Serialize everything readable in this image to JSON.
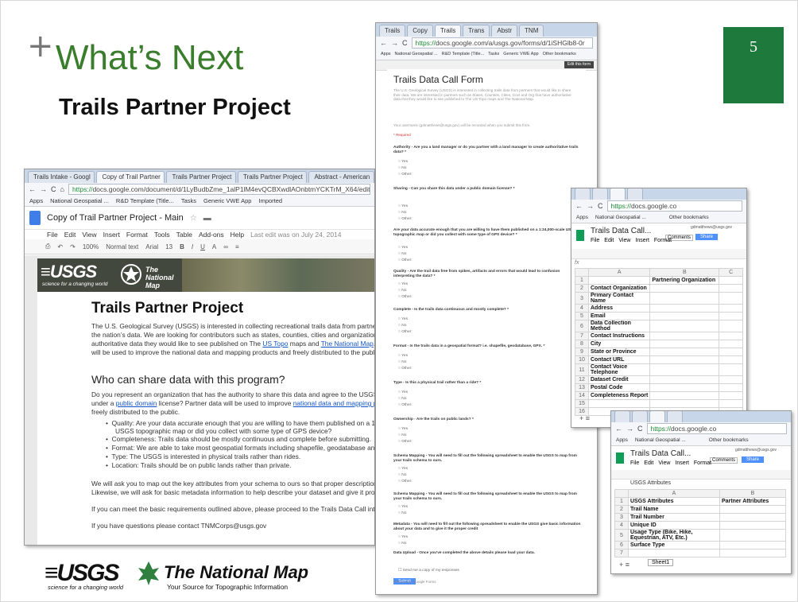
{
  "slide": {
    "plus": "+",
    "title": "What’s Next",
    "subtitle": "Trails Partner Project",
    "page_number": "5",
    "page_box_color": "#1e7a3c",
    "title_color": "#3a7d2c"
  },
  "docs_window": {
    "tabs": [
      "Trails Intake - Googl",
      "Copy of Trail Partner",
      "Trails Partner Project",
      "Trails Partner Project",
      "Abstract - American"
    ],
    "active_tab_index": 1,
    "url_scheme": "https://",
    "url_rest": "docs.google.com/document/d/1LyBudbZme_1alP1lM4evQCBXwdlAOnbtmYCKTrM_X64/edit",
    "bookmarks": [
      "Apps",
      "National Geospatial ...",
      "R&D Template (Title...",
      "Tasks",
      "Generic VWE App",
      "Imported"
    ],
    "doc_title": "Copy of Trail Partner Project - Main",
    "menu": [
      "File",
      "Edit",
      "View",
      "Insert",
      "Format",
      "Tools",
      "Table",
      "Add-ons",
      "Help"
    ],
    "last_edit": "Last edit was on July 24, 2014",
    "toolbar": {
      "zoom": "100%",
      "style": "Normal text",
      "font": "Arial",
      "size": "13"
    },
    "banner_logo": "≡USGS",
    "banner_tagline": "science for a changing world",
    "banner_national_map": "The National Map",
    "heading": "Trails Partner Project",
    "intro_1": "The U.S. Geological Survey (USGS) is interested in collecting recreational trails data from partner",
    "intro_2": "the nation’s data. We are looking for contributors such as states, counties, cities and organizations",
    "intro_3a": "authoritative data they would like to see published on The ",
    "intro_3_link1": "US Topo",
    "intro_3b": " maps and ",
    "intro_3_link2": "The National Map",
    "intro_3c": ".",
    "intro_4": "will be used to improve the national data and mapping products and freely distributed to the public",
    "subheading": "Who can share data with this program?",
    "who_1": "Do you represent an organization that has the authority to share this data and agree to the USGS",
    "who_2a": "under a ",
    "who_2_link1": "public domain",
    "who_2b": " license? Partner data will be used to improve ",
    "who_2_link2": "national data and mapping pr",
    "who_3": "freely distributed to the public.",
    "bullets": [
      "Quality: Are your data accurate enough that you are willing to have them published on a 1:2",
      "USGS topographic map or did you collect with some type of GPS device?",
      "Completeness: Trails data should be mostly continuous and complete before submitting.",
      "Format: We are able to take most geospatial formats including shapefile, geodatabase and",
      "Type: The USGS is interested in physical trails rather than rides.",
      "Location: Trails should be on public lands rather than private."
    ],
    "closing_1": "We will ask you to map out the key attributes from your schema to ours so that proper descriptions",
    "closing_2": "Likewise, we will ask for basic metadata information to help describe your dataset and give it prope",
    "closing_3": "If you can meet the basic requirements outlined above, please proceed to the Trails Data Call inta",
    "closing_4": "If you have questions please contact TNMCorps@usgs.gov"
  },
  "form_window": {
    "tabs": [
      "Trails",
      "Copy",
      "Trails",
      "Trans",
      "Abstr",
      "TNM"
    ],
    "url_scheme": "https://",
    "url_rest": "docs.google.com/a/usgs.gov/forms/d/1iSHGlb8-0r",
    "bookmarks": [
      "Apps",
      "National Geospatial ...",
      "R&D Template (Title...",
      "Tasks",
      "Generic VWE App",
      "Other bookmarks"
    ],
    "edit_button": "Edit this form",
    "form_title": "Trails Data Call Form",
    "intro": "The U.S. Geological Survey (USGS) is interested in collecting trails data from partners that would like to share their data. We are interested in partners such as States, Counties, Cities, Govt and Org that have authoritative data that they would like to see published to The US Topo maps and The National Map.",
    "username_note": "Your username (gdmatthews@usgs.gov) will be recorded when you submit this form.",
    "required": "* Required",
    "questions": [
      "Authority - Are you a land manager or do you partner with a land manager to create authoritative trails data? *",
      "Sharing - Can you share this data under a public domain license? *",
      "Are your data accurate enough that you are willing to have them published on a 1:24,000-scale USGS topographic map or did you collect with some type of GPS device? *",
      "Quality - Are the trail data free from spikes, artifacts and errors that would lead to confusion interpreting the data? *",
      "Complete - Is the trails data continuous and mostly complete? *",
      "Format - Is the trails data in a geospatial format? i.e. shapefile, geodatabase, GPX. *",
      "Type - Is this a physical trail rather than a ride? *",
      "Ownership - Are the trails on public lands? *",
      "Schema Mapping - You will need to fill out the following spreadsheet to enable the USGS to map from your trails schema to ours.",
      "Schema Mapping - You will need to fill out the following spreadsheet to enable the USGS to map from your trails schema to ours.",
      "Metadata - You will need to fill out the following spreadsheet to enable the USGS give basic information about your data and to give it the proper credit",
      "Data Upload - Once you've completed the above details please load your data."
    ],
    "options": [
      "Yes",
      "No",
      "Other:"
    ],
    "send_copy": "Send me a copy of my responses",
    "submit": "Submit",
    "footer": "Powered by Google Forms"
  },
  "sheet1_window": {
    "url_scheme": "https://",
    "url_rest": "docs.google.co",
    "bookmarks": [
      "Apps",
      "National Geospatial ...",
      "Other bookmarks"
    ],
    "title": "Trails Data Call...",
    "user": "gdmatthews@usgs.gov",
    "comments": "Comments",
    "share": "Share",
    "menu": [
      "File",
      "Edit",
      "View",
      "Insert",
      "Format"
    ],
    "fx": "fx",
    "col_a": "A",
    "col_b": "B",
    "col_c": "C",
    "header_b": "Partnering Organization",
    "rows": [
      "",
      "Contact Organization",
      "Primary Contact Name",
      "Address",
      "Email",
      "Data Collection Method",
      "Contact Instructions",
      "City",
      "State or Province",
      "Contact URL",
      "Contact Voice Telephone",
      "Dataset Credit",
      "Postal Code",
      "Completeness Report",
      "",
      ""
    ]
  },
  "sheet2_window": {
    "url_scheme": "https://",
    "url_rest": "docs.google.co",
    "bookmarks": [
      "Apps",
      "National Geospatial ...",
      "Other bookmarks"
    ],
    "title": "Trails Data Call...",
    "user": "gdmatthews@usgs.gov",
    "comments": "Comments",
    "share": "Share",
    "menu": [
      "File",
      "Edit",
      "View",
      "Insert",
      "Format"
    ],
    "fx_label": "USGS Attributes",
    "col_a": "A",
    "col_b": "B",
    "rows": [
      {
        "a": "USGS Attributes",
        "b": "Partner Attributes"
      },
      {
        "a": "Trail Name",
        "b": ""
      },
      {
        "a": "Trail Number",
        "b": ""
      },
      {
        "a": "Unique ID",
        "b": ""
      },
      {
        "a": "Usage Type (Bike, Hike, Equestrian, ATV, Etc.)",
        "b": ""
      },
      {
        "a": "Surface Type",
        "b": ""
      },
      {
        "a": "",
        "b": ""
      }
    ],
    "sheet_tab": "Sheet1"
  },
  "logos": {
    "usgs": "≡USGS",
    "usgs_tagline": "science for a changing world",
    "tnm": "The National Map",
    "tnm_sub": "Your Source for Topographic Information"
  }
}
